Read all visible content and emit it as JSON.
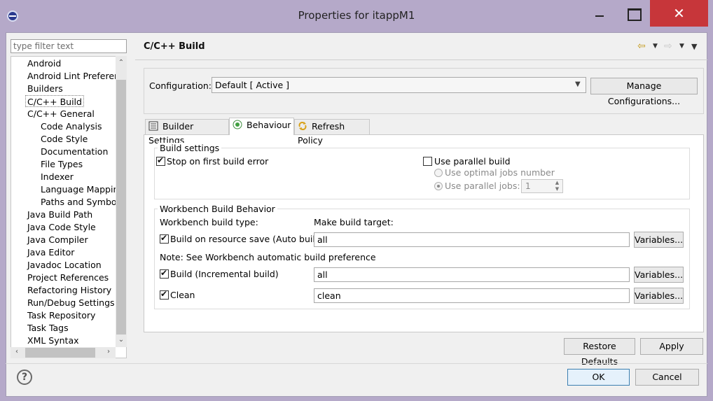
{
  "window": {
    "title": "Properties for itappM1",
    "close_glyph": "✕"
  },
  "sidebar": {
    "filter_placeholder": "type filter text",
    "items": [
      {
        "label": "Android",
        "level": 0
      },
      {
        "label": "Android Lint Preferenc",
        "level": 0
      },
      {
        "label": "Builders",
        "level": 0
      },
      {
        "label": "C/C++ Build",
        "level": 0,
        "selected": true
      },
      {
        "label": "C/C++ General",
        "level": 0
      },
      {
        "label": "Code Analysis",
        "level": 1
      },
      {
        "label": "Code Style",
        "level": 1
      },
      {
        "label": "Documentation",
        "level": 1
      },
      {
        "label": "File Types",
        "level": 1
      },
      {
        "label": "Indexer",
        "level": 1
      },
      {
        "label": "Language Mappin",
        "level": 1
      },
      {
        "label": "Paths and Symbols",
        "level": 1
      },
      {
        "label": "Java Build Path",
        "level": 0
      },
      {
        "label": "Java Code Style",
        "level": 0
      },
      {
        "label": "Java Compiler",
        "level": 0
      },
      {
        "label": "Java Editor",
        "level": 0
      },
      {
        "label": "Javadoc Location",
        "level": 0
      },
      {
        "label": "Project References",
        "level": 0
      },
      {
        "label": "Refactoring History",
        "level": 0
      },
      {
        "label": "Run/Debug Settings",
        "level": 0
      },
      {
        "label": "Task Repository",
        "level": 0
      },
      {
        "label": "Task Tags",
        "level": 0
      },
      {
        "label": "XML Syntax",
        "level": 0
      }
    ]
  },
  "page": {
    "title": "C/C++ Build"
  },
  "configuration": {
    "label": "Configuration:",
    "value": "Default  [ Active ]",
    "manage_button": "Manage Configurations..."
  },
  "tabs": [
    {
      "label": "Builder Settings",
      "icon": "list-icon"
    },
    {
      "label": "Behaviour",
      "icon": "radio-icon",
      "active": true
    },
    {
      "label": "Refresh Policy",
      "icon": "refresh-icon"
    }
  ],
  "build_settings": {
    "title": "Build settings",
    "stop_on_error": {
      "label": "Stop on first build error",
      "checked": true
    },
    "parallel_build": {
      "label": "Use parallel build",
      "checked": false
    },
    "optimal_jobs": {
      "label": "Use optimal jobs number",
      "selected": false
    },
    "parallel_jobs": {
      "label": "Use parallel jobs:",
      "selected": true,
      "value": "1"
    }
  },
  "workbench": {
    "title": "Workbench Build Behavior",
    "type_label": "Workbench build type:",
    "target_label": "Make build target:",
    "auto_build": {
      "label": "Build on resource save (Auto build)",
      "checked": true,
      "target": "all"
    },
    "note": "Note: See Workbench automatic build preference",
    "incremental": {
      "label": "Build (Incremental build)",
      "checked": true,
      "target": "all"
    },
    "clean": {
      "label": "Clean",
      "checked": true,
      "target": "clean"
    },
    "variables_button": "Variables..."
  },
  "footer": {
    "restore_defaults": "Restore Defaults",
    "apply": "Apply",
    "ok": "OK",
    "cancel": "Cancel"
  }
}
